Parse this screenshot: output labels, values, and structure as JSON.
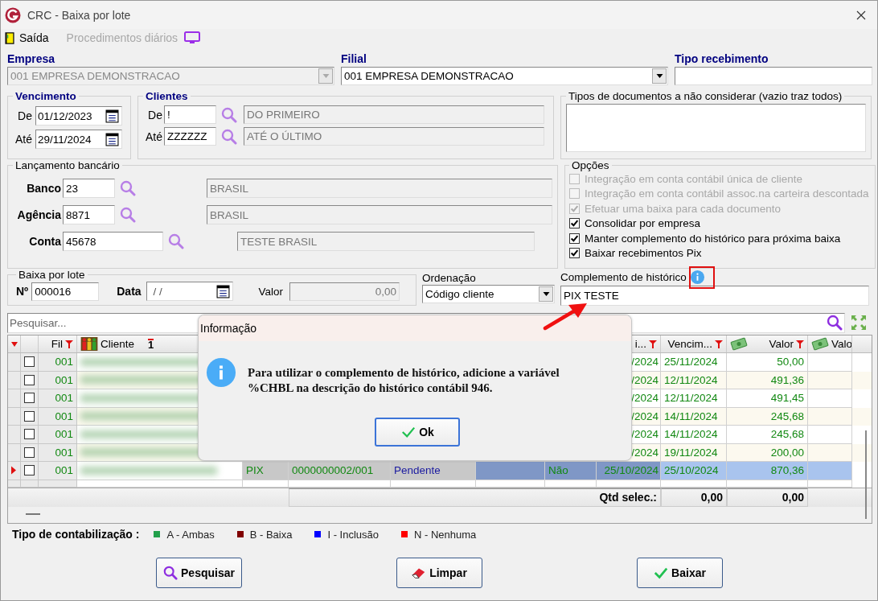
{
  "window": {
    "title": "CRC - Baixa por lote"
  },
  "toolbar": [
    {
      "label": "Saída",
      "disabled": false,
      "kind": "exit"
    },
    {
      "label": "Procedimentos diários",
      "disabled": true,
      "kind": "monitor"
    }
  ],
  "empresa": {
    "label": "Empresa",
    "value": "001 EMPRESA DEMONSTRACAO",
    "disabled": true
  },
  "filial": {
    "label": "Filial",
    "value": "001 EMPRESA DEMONSTRACAO",
    "disabled": false
  },
  "tipo_recebimento": {
    "label": "Tipo recebimento"
  },
  "vencimento": {
    "title": "Vencimento",
    "fields": [
      {
        "label": "De",
        "value": "01/12/2023"
      },
      {
        "label": "Até",
        "value": "29/11/2024"
      }
    ]
  },
  "clientes": {
    "title": "Clientes",
    "fields": [
      {
        "label": "De",
        "code": "!",
        "name": "DO PRIMEIRO"
      },
      {
        "label": "Até",
        "code": "ZZZZZZ",
        "name": "ATÉ O ÚLTIMO"
      }
    ]
  },
  "tipos_documentos": {
    "title": "Tipos de documentos a não considerar (vazio traz todos)"
  },
  "lancamento_bancario": {
    "title": "Lançamento bancário",
    "fields": [
      {
        "label": "Banco",
        "code": "23",
        "name": "BRASIL"
      },
      {
        "label": "Agência",
        "code": "8871",
        "name": "BRASIL"
      },
      {
        "label": "Conta",
        "code": "45678",
        "name": "TESTE BRASIL"
      }
    ]
  },
  "opcoes": {
    "title": "Opções",
    "items": [
      {
        "label": "Integração em conta contábil única de cliente",
        "checked": false,
        "disabled": true
      },
      {
        "label": "Integração em conta contábil assoc.na carteira descontada",
        "checked": false,
        "disabled": true
      },
      {
        "label": "Efetuar uma baixa para cada documento",
        "checked": true,
        "disabled": true
      },
      {
        "label": "Consolidar por empresa",
        "checked": true,
        "disabled": false
      },
      {
        "label": "Manter complemento do histórico para próxima baixa",
        "checked": true,
        "disabled": false
      },
      {
        "label": "Baixar recebimentos Pix",
        "checked": true,
        "disabled": false
      }
    ]
  },
  "baixa_por_lote": {
    "title": "Baixa por lote",
    "numero": {
      "label": "Nº",
      "value": "000016"
    },
    "data": {
      "label": "Data",
      "value": "/ /"
    },
    "valor": {
      "label": "Valor",
      "value": "0,00"
    }
  },
  "ordenacao": {
    "label": "Ordenação",
    "value": "Código cliente"
  },
  "complemento": {
    "label": "Complemento de histórico",
    "value": "PIX TESTE"
  },
  "search": {
    "placeholder": "Pesquisar..."
  },
  "grid": {
    "headers": {
      "fil": {
        "label": "Fil",
        "filter": true
      },
      "cliente": {
        "label": "Cliente",
        "sort": "1",
        "filter": false,
        "kind": "client"
      },
      "column_10": {
        "label": "i...",
        "filter": true
      },
      "vencimento": {
        "label": "Vencim...",
        "filter": true
      },
      "valor": {
        "label": "Valor",
        "filter": true,
        "kind": "money"
      },
      "column_13": {
        "label": "Valo",
        "filter": false,
        "kind": "money"
      }
    },
    "rows": [
      {
        "selected": false,
        "checked": false,
        "fil": "001",
        "column_10": "/2024",
        "vencimento": "25/11/2024",
        "valor": "50,00"
      },
      {
        "selected": false,
        "checked": false,
        "fil": "001",
        "column_10": "/2024",
        "vencimento": "12/11/2024",
        "valor": "491,36"
      },
      {
        "selected": false,
        "checked": false,
        "fil": "001",
        "column_10": "/2024",
        "vencimento": "12/11/2024",
        "valor": "491,45"
      },
      {
        "selected": false,
        "checked": false,
        "fil": "001",
        "column_10": "/2024",
        "vencimento": "14/11/2024",
        "valor": "245,68"
      },
      {
        "selected": false,
        "checked": false,
        "fil": "001",
        "column_10": "/2024",
        "vencimento": "14/11/2024",
        "valor": "245,68"
      },
      {
        "selected": false,
        "checked": false,
        "fil": "001",
        "column_10": "/2024",
        "vencimento": "19/11/2024",
        "valor": "200,00"
      },
      {
        "selected": true,
        "checked": false,
        "fil": "001",
        "column_5": "PIX",
        "column_6": "0000000002/001",
        "column_7": "Pendente",
        "column_9": "Não",
        "column_10": "25/10/2024",
        "vencimento": "25/10/2024",
        "valor": "870,36"
      }
    ],
    "footer": {
      "label": "Qtd selec.:",
      "vencimento": "0,00",
      "valor": "0,00"
    }
  },
  "legend": {
    "title": "Tipo de contabilização :",
    "items": [
      {
        "label": "A - Ambas",
        "color": "#22a04b"
      },
      {
        "label": "B - Baixa",
        "color": "#800000"
      },
      {
        "label": "I - Inclusão",
        "color": "#0000ff"
      },
      {
        "label": "N - Nenhuma",
        "color": "#ff0000"
      }
    ]
  },
  "buttons": [
    {
      "label": "Pesquisar",
      "kind": "search"
    },
    {
      "label": "Limpar",
      "kind": "eraser"
    },
    {
      "label": "Baixar",
      "kind": "check"
    }
  ],
  "dialog": {
    "title": "Informação",
    "message": "Para utilizar o complemento de histórico, adicione a variável %CHBL na descrição do histórico contábil 946.",
    "button": "Ok"
  }
}
